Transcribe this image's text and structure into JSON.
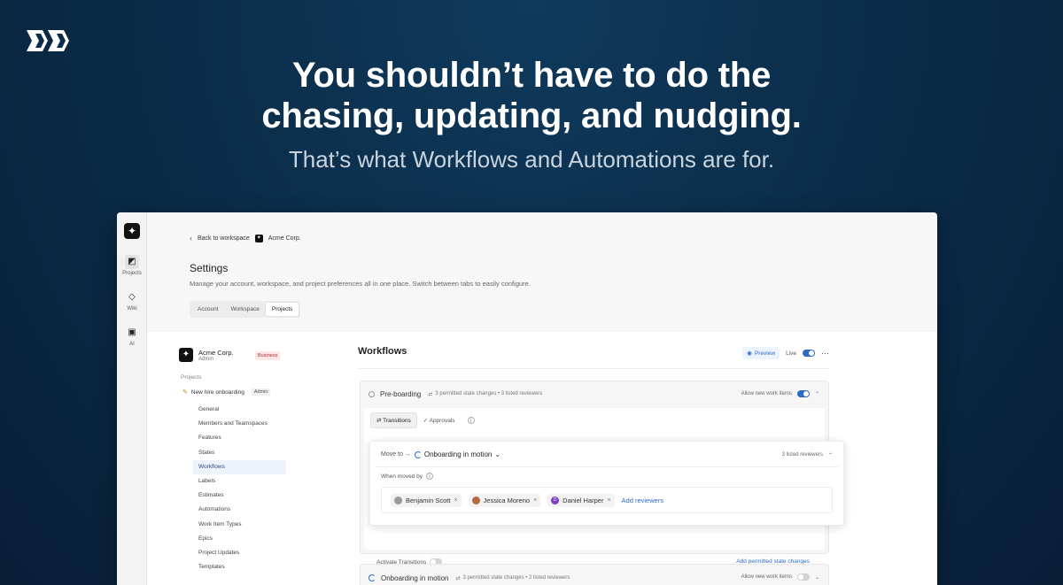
{
  "hero": {
    "headline_line1": "You shouldn’t have to do the",
    "headline_line2": "chasing, updating, and nudging.",
    "subheadline": "That’s what Workflows and Automations are for."
  },
  "rail": {
    "items": [
      {
        "label": "Projects",
        "icon": "projects-icon"
      },
      {
        "label": "Wiki",
        "icon": "wiki-icon"
      },
      {
        "label": "AI",
        "icon": "ai-icon"
      }
    ]
  },
  "topbar": {
    "back_label": "Back to workspace",
    "workspace_label": "Acme Corp."
  },
  "settings": {
    "title": "Settings",
    "description": "Manage your account, workspace, and project preferences all in one place. Switch between tabs to easily configure.",
    "tabs": [
      "Account",
      "Workspace",
      "Projects"
    ],
    "active_tab": "Projects"
  },
  "sidebar": {
    "workspace_name": "Acme Corp.",
    "workspace_role": "Admin",
    "plan_badge": "Business",
    "section_label": "Projects",
    "project_name": "New hire onboarding",
    "project_role": "Admin",
    "nav": [
      "General",
      "Members and Teamspaces",
      "Features",
      "States",
      "Workflows",
      "Labels",
      "Estimates",
      "Automations",
      "Work Item Types",
      "Epics",
      "Project Updates",
      "Templates"
    ],
    "active_nav": "Workflows"
  },
  "workflows": {
    "title": "Workflows",
    "preview_label": "Preview",
    "live_label": "Live",
    "live_on": true
  },
  "state1": {
    "name": "Pre-boarding",
    "meta": "3 permitted state changes • 3 listed reviewers",
    "allow_label": "Allow new work items",
    "allow_on": true,
    "subtabs": [
      "Transitions",
      "Approvals"
    ],
    "transition": {
      "move_to_label": "Move to →",
      "target_state": "Onboarding in motion",
      "reviewer_count": "3 listed reviewers",
      "when_moved_label": "When moved by",
      "reviewers": [
        {
          "name": "Benjamin Scott",
          "color": "#9b9b9b"
        },
        {
          "name": "Jessica Moreno",
          "color": "#b46a3c"
        },
        {
          "name": "Daniel Harper",
          "color": "#7b3fc4",
          "initial": "D"
        }
      ],
      "add_reviewers_label": "Add reviewers"
    },
    "activate_label": "Activate Transitions",
    "add_permitted_label": "Add permitted state changes"
  },
  "state2": {
    "name": "Onboarding in motion",
    "meta": "3 permitted state changes • 2 listed reviewers",
    "allow_label": "Allow new work items",
    "allow_on": false
  }
}
